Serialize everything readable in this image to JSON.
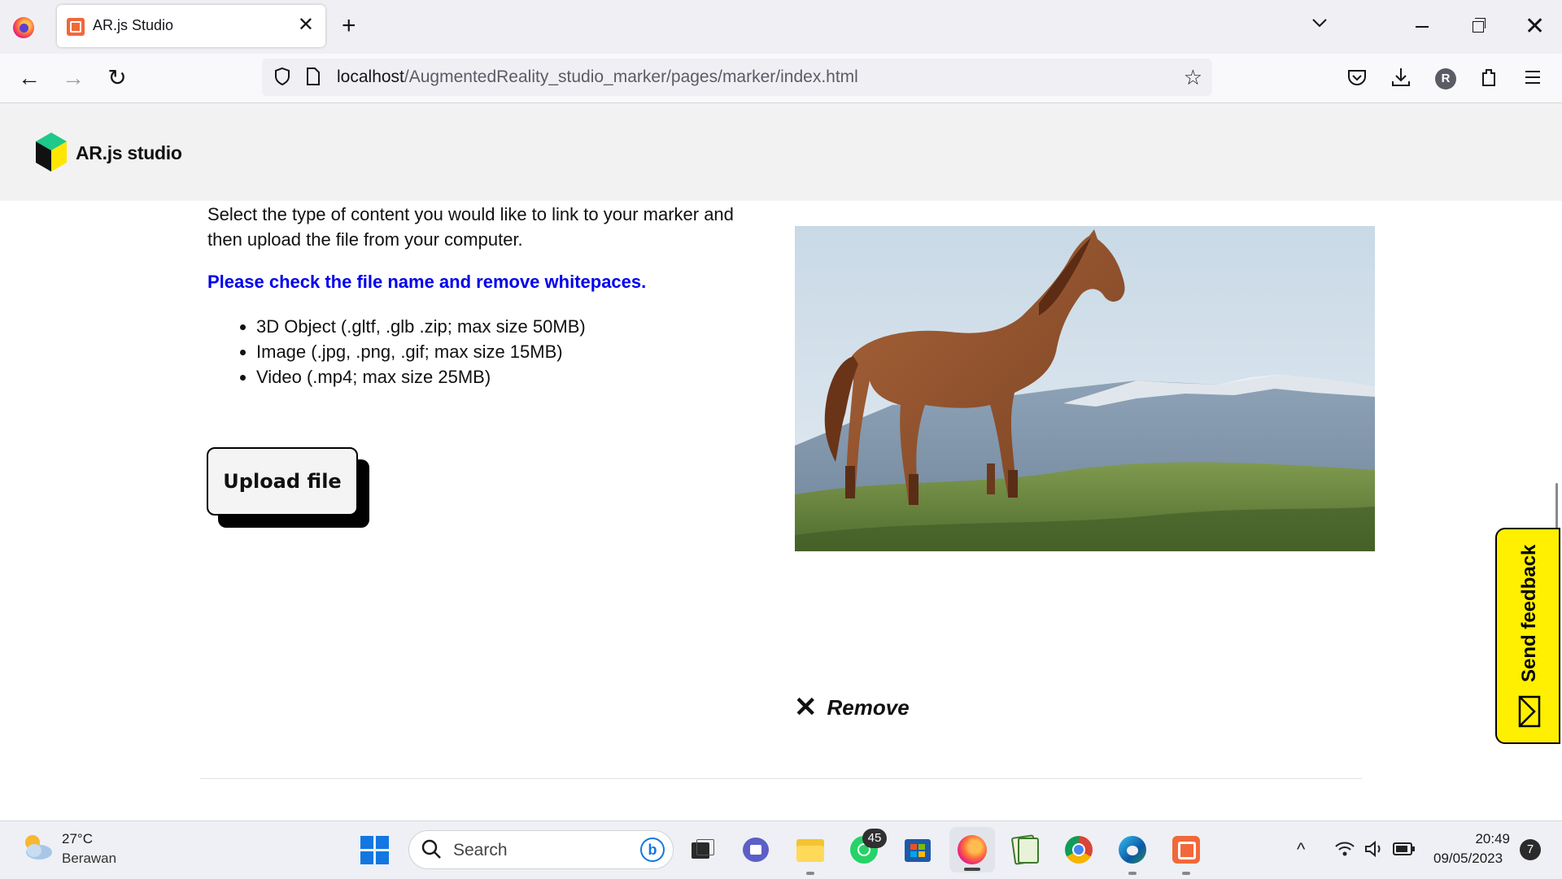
{
  "browser": {
    "tab_title": "AR.js Studio",
    "url_host": "localhost",
    "url_path": "/AugmentedReality_studio_marker/pages/marker/index.html",
    "profile_initial": "R"
  },
  "site": {
    "brand": "AR.js studio"
  },
  "main": {
    "intro": "Select the type of content you would like to link to your marker and then upload the file from your computer.",
    "warning": "Please check the file name and remove whitepaces.",
    "warning_color": "#0000ee",
    "file_types": [
      "3D Object (.gltf, .glb .zip; max size 50MB)",
      "Image (.jpg, .png, .gif; max size 15MB)",
      "Video (.mp4; max size 25MB)"
    ],
    "upload_label": "Upload file",
    "remove_label": "Remove"
  },
  "feedback": {
    "label": "Send feedback",
    "color": "#ffef00"
  },
  "taskbar": {
    "temperature": "27°C",
    "weather": "Berawan",
    "search_placeholder": "Search",
    "whatsapp_badge": "45",
    "time": "20:49",
    "date": "09/05/2023",
    "notifications": "7"
  }
}
